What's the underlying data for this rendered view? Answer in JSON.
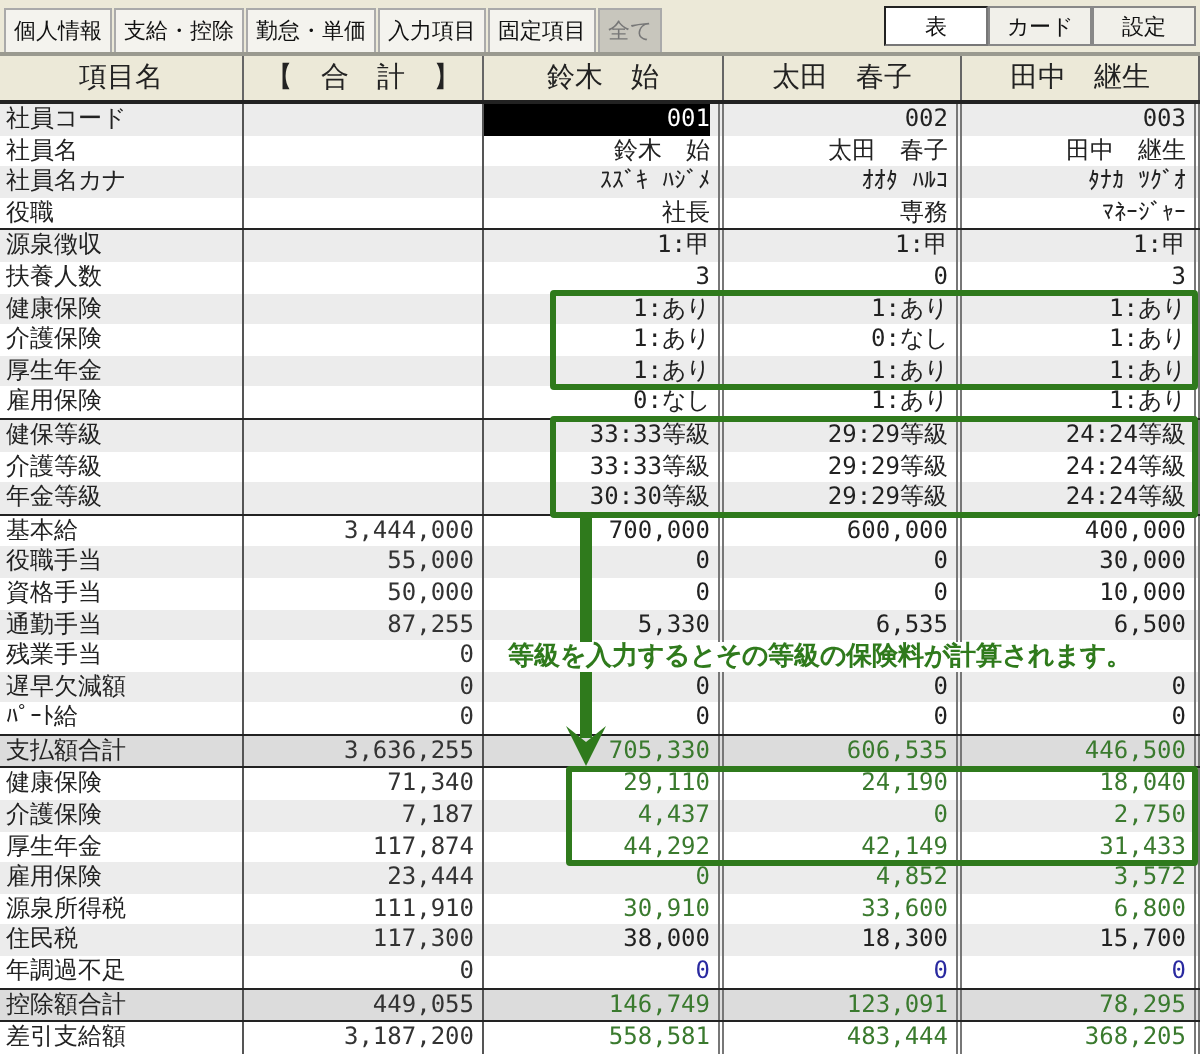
{
  "tabs": [
    {
      "label": "個人情報",
      "selected": false
    },
    {
      "label": "支給・控除",
      "selected": false
    },
    {
      "label": "勤怠・単価",
      "selected": false
    },
    {
      "label": "入力項目",
      "selected": false
    },
    {
      "label": "固定項目",
      "selected": false
    },
    {
      "label": "全て",
      "selected": true
    }
  ],
  "view_buttons": [
    {
      "label": "表",
      "selected": true
    },
    {
      "label": "カード",
      "selected": false
    },
    {
      "label": "設定",
      "selected": false
    }
  ],
  "table": {
    "columns": [
      "項目名",
      "【　合　計　】"
    ],
    "employees": [
      {
        "name": "鈴木　始",
        "cursor": true
      },
      {
        "name": "太田　春子",
        "cursor": false
      },
      {
        "name": "田中　継生",
        "cursor": false
      }
    ],
    "sections": [
      {
        "rows": [
          {
            "label": "社員コード",
            "kind": "input",
            "cells": [
              "001",
              "002",
              "003"
            ]
          },
          {
            "label": "社員名",
            "kind": "input",
            "cells": [
              "鈴木　始",
              "太田　春子",
              "田中　継生"
            ]
          },
          {
            "label": "社員名カナ",
            "kind": "input",
            "cells": [
              "ｽｽﾞｷ ﾊｼﾞﾒ",
              "ｵｵﾀ ﾊﾙｺ",
              "ﾀﾅｶ ﾂｸﾞｵ"
            ]
          },
          {
            "label": "役職",
            "kind": "input",
            "cells": [
              "社長",
              "専務",
              "ﾏﾈｰｼﾞｬｰ"
            ]
          }
        ]
      },
      {
        "rows": [
          {
            "label": "源泉徴収",
            "kind": "input",
            "cells": [
              "1:甲",
              "1:甲",
              "1:甲"
            ]
          },
          {
            "label": "扶養人数",
            "kind": "input",
            "cells": [
              "3",
              "0",
              "3"
            ]
          },
          {
            "label": "健康保険",
            "kind": "input",
            "cells": [
              "1:あり",
              "1:あり",
              "1:あり"
            ]
          },
          {
            "label": "介護保険",
            "kind": "input",
            "cells": [
              "1:あり",
              "0:なし",
              "1:あり"
            ]
          },
          {
            "label": "厚生年金",
            "kind": "input",
            "cells": [
              "1:あり",
              "1:あり",
              "1:あり"
            ]
          },
          {
            "label": "雇用保険",
            "kind": "input",
            "cells": [
              "0:なし",
              "1:あり",
              "1:あり"
            ]
          }
        ]
      },
      {
        "rows": [
          {
            "label": "健保等級",
            "kind": "input",
            "cells": [
              "33:33等級",
              "29:29等級",
              "24:24等級"
            ]
          },
          {
            "label": "介護等級",
            "kind": "input",
            "cells": [
              "33:33等級",
              "29:29等級",
              "24:24等級"
            ]
          },
          {
            "label": "年金等級",
            "kind": "input",
            "cells": [
              "30:30等級",
              "29:29等級",
              "24:24等級"
            ]
          }
        ]
      },
      {
        "rows": [
          {
            "label": "基本給",
            "kind": "input",
            "total": "3,444,000",
            "cells": [
              "700,000",
              "600,000",
              "400,000"
            ]
          },
          {
            "label": "役職手当",
            "kind": "input",
            "total": "55,000",
            "cells": [
              "0",
              "0",
              "30,000"
            ]
          },
          {
            "label": "資格手当",
            "kind": "input",
            "total": "50,000",
            "cells": [
              "0",
              "0",
              "10,000"
            ]
          },
          {
            "label": "通勤手当",
            "kind": "input",
            "total": "87,255",
            "cells": [
              "5,330",
              "6,535",
              "6,500"
            ]
          },
          {
            "label": "残業手当",
            "kind": "input",
            "total": "0",
            "cells": [
              null,
              null,
              null
            ]
          },
          {
            "label": "遅早欠減額",
            "kind": "input",
            "total": "0",
            "cells": [
              "0",
              "0",
              "0"
            ]
          },
          {
            "label": "ﾊﾟｰﾄ給",
            "kind": "input",
            "total": "0",
            "cells": [
              "0",
              "0",
              "0"
            ]
          }
        ]
      },
      {
        "rows": [
          {
            "label": "支払額合計",
            "kind": "sum",
            "total": "3,636,255",
            "cells": [
              "705,330",
              "606,535",
              "446,500"
            ]
          }
        ]
      },
      {
        "rows": [
          {
            "label": "健康保険",
            "kind": "calc",
            "total": "71,340",
            "cells": [
              "29,110",
              "24,190",
              "18,040"
            ]
          },
          {
            "label": "介護保険",
            "kind": "calc",
            "total": "7,187",
            "cells": [
              "4,437",
              "0",
              "2,750"
            ]
          },
          {
            "label": "厚生年金",
            "kind": "calc",
            "total": "117,874",
            "cells": [
              "44,292",
              "42,149",
              "31,433"
            ]
          },
          {
            "label": "雇用保険",
            "kind": "calc",
            "total": "23,444",
            "cells": [
              "0",
              "4,852",
              "3,572"
            ]
          },
          {
            "label": "源泉所得税",
            "kind": "calc",
            "total": "111,910",
            "cells": [
              "30,910",
              "33,600",
              "6,800"
            ]
          },
          {
            "label": "住民税",
            "kind": "input",
            "total": "117,300",
            "cells": [
              "38,000",
              "18,300",
              "15,700"
            ]
          },
          {
            "label": "年調過不足",
            "kind": "adjust",
            "total": "0",
            "cells": [
              "0",
              "0",
              "0"
            ]
          }
        ]
      },
      {
        "rows": [
          {
            "label": "控除額合計",
            "kind": "sum",
            "total": "449,055",
            "cells": [
              "146,749",
              "123,091",
              "78,295"
            ]
          }
        ]
      },
      {
        "rows": [
          {
            "label": "差引支給額",
            "kind": "calc",
            "total": "3,187,200",
            "cells": [
              "558,581",
              "483,444",
              "368,205"
            ]
          }
        ]
      }
    ]
  },
  "annotation": {
    "text": "等級を入力するとその等級の保険料が計算されます。"
  }
}
